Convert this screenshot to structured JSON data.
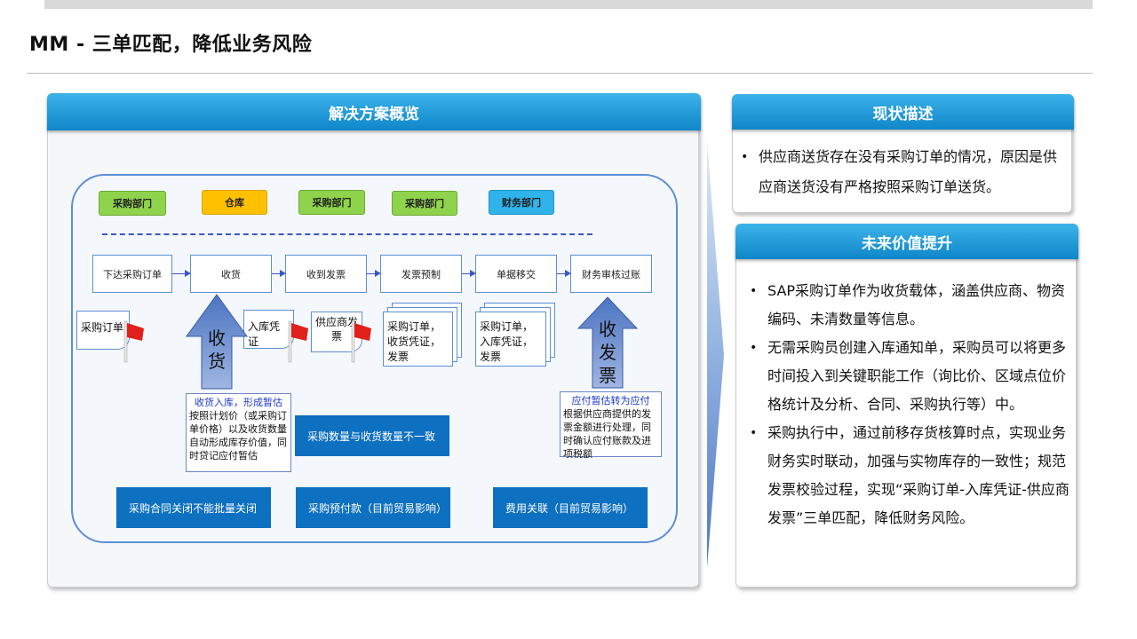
{
  "page": {
    "title": "MM - 三单匹配，降低业务风险"
  },
  "solution": {
    "header": "解决方案概览",
    "departments": [
      "采购部门",
      "仓库",
      "采购部门",
      "采购部门",
      "财务部门"
    ],
    "steps": [
      "下达采购订单",
      "收货",
      "收到发票",
      "发票预制",
      "单据移交",
      "财务审核过账"
    ],
    "docs": {
      "po": "采购订单",
      "gr": "入库凭证",
      "invoice": "供应商发票",
      "set1": "采购订单，收货凭证，发票",
      "set2": "采购订单，入库凭证，发票"
    },
    "big_arrows": {
      "receive": "收货",
      "invoice": "收发票"
    },
    "gr_desc": {
      "heading": "收货入库，形成暂估",
      "body": "按照计划价（或采购订单价格）以及收货数量自动形成库存价值，同时贷记应付暂估"
    },
    "ap_desc": {
      "heading": "应付暂估转为应付",
      "body": "根据供应商提供的发票金额进行处理，同时确认应付账款及进项税额"
    },
    "issues": [
      "采购数量与收货数量不一致",
      "采购合同关闭不能批量关闭",
      "采购预付款（目前贸易影响）",
      "费用关联（目前贸易影响）"
    ]
  },
  "current": {
    "header": "现状描述",
    "bullets": [
      "供应商送货存在没有采购订单的情况，原因是供应商送货没有严格按照采购订单送货。"
    ]
  },
  "future": {
    "header": "未来价值提升",
    "bullets": [
      "SAP采购订单作为收货载体，涵盖供应商、物资编码、未清数量等信息。",
      "无需采购员创建入库通知单，采购员可以将更多时间投入到关键职能工作（询比价、区域点位价格统计及分析、合同、采购执行等）中。",
      "采购执行中，通过前移存货核算时点，实现业务财务实时联动，加强与实物库存的一致性；规范发票校验过程，实现“采购订单-入库凭证-供应商发票”三单匹配，降低财务风险。"
    ]
  },
  "colors": {
    "header_blue": "#1a96d6",
    "navy": "#0e70c0",
    "dept_green": "#8fd24c",
    "dept_orange": "#ffc000",
    "dept_blue": "#2fb3ea",
    "flag_red": "#e0201b"
  }
}
